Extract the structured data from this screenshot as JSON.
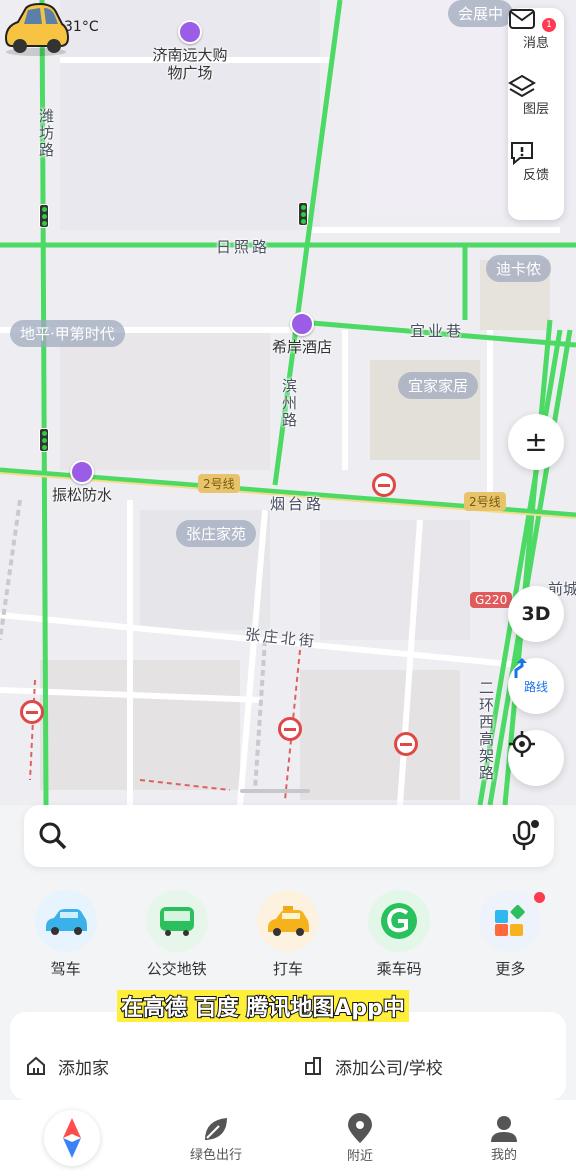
{
  "weather": {
    "temperature": "31°C",
    "icon": "cloud-rain-icon"
  },
  "map": {
    "roads": [
      "潍坊路",
      "日照路",
      "滨州路",
      "宜业巷",
      "烟台路",
      "张庄北街",
      "二环西高架路"
    ],
    "pois": [
      "济南远大购物广场",
      "希岸酒店",
      "振松防水"
    ],
    "chips": [
      "地平·甲第时代",
      "宜家家居",
      "迪卡侬",
      "张庄家苑",
      "会展中",
      "前城"
    ],
    "line_badges": [
      "2号线",
      "2号线"
    ],
    "highway_badge": "G220"
  },
  "right_panel": {
    "items": [
      {
        "label": "消息",
        "icon": "mail-icon",
        "badge": "1"
      },
      {
        "label": "图层",
        "icon": "layers-icon"
      },
      {
        "label": "反馈",
        "icon": "feedback-icon"
      }
    ]
  },
  "map_controls": {
    "zoom": "±",
    "threed": "3D",
    "route": "路线"
  },
  "search": {
    "placeholder": ""
  },
  "quick_actions": [
    {
      "label": "驾车",
      "icon": "car-icon"
    },
    {
      "label": "公交地铁",
      "icon": "bus-icon"
    },
    {
      "label": "打车",
      "icon": "taxi-icon"
    },
    {
      "label": "乘车码",
      "icon": "ride-code-icon"
    },
    {
      "label": "更多",
      "icon": "more-icon"
    }
  ],
  "caption": {
    "before": "在高德 百度 腾讯地图App中",
    "after": ""
  },
  "favorites": {
    "home": "添加家",
    "work": "添加公司/学校"
  },
  "bottom_nav": [
    {
      "label": "",
      "icon": "compass-icon"
    },
    {
      "label": "绿色出行",
      "icon": "leaf-icon"
    },
    {
      "label": "附近",
      "icon": "location-pin-icon"
    },
    {
      "label": "我的",
      "icon": "user-icon"
    }
  ],
  "colors": {
    "accent": "#1a73e8",
    "road_green": "#4cd964",
    "alert": "#ff3b4f"
  }
}
